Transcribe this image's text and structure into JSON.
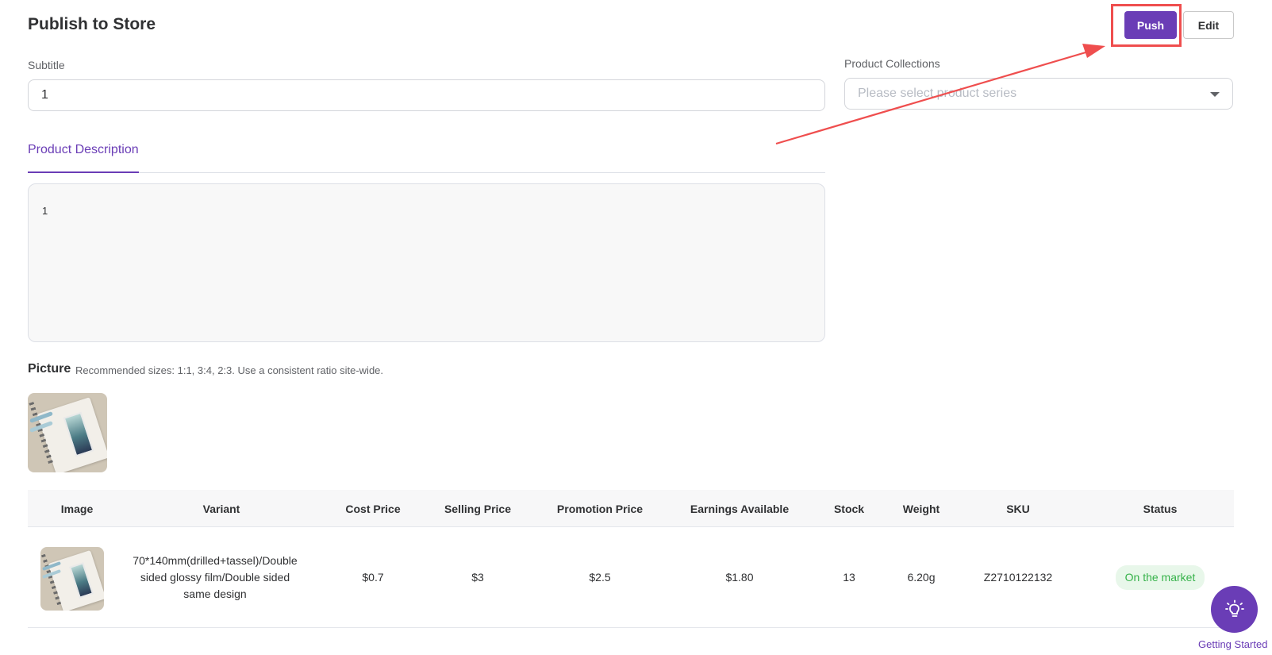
{
  "header": {
    "title": "Publish to Store",
    "push_label": "Push",
    "edit_label": "Edit"
  },
  "form": {
    "subtitle_label": "Subtitle",
    "subtitle_value": "1",
    "collections_label": "Product Collections",
    "collections_placeholder": "Please select product series"
  },
  "tabs": {
    "active_label": "Product Description"
  },
  "description": {
    "content": "1"
  },
  "picture": {
    "title": "Picture",
    "hint": "Recommended sizes: 1:1, 3:4, 2:3. Use a consistent ratio site-wide."
  },
  "table": {
    "headers": [
      "Image",
      "Variant",
      "Cost Price",
      "Selling Price",
      "Promotion Price",
      "Earnings Available",
      "Stock",
      "Weight",
      "SKU",
      "Status"
    ],
    "rows": [
      {
        "variant": "70*140mm(drilled+tassel)/Double sided glossy film/Double sided same design",
        "cost_price": "$0.7",
        "selling_price": "$3",
        "promotion_price": "$2.5",
        "earnings": "$1.80",
        "stock": "13",
        "weight": "6.20g",
        "sku": "Z2710122132",
        "status": "On the market"
      }
    ]
  },
  "fab": {
    "label": "Getting Started",
    "icon": "lightbulb-icon"
  },
  "colors": {
    "accent": "#6a3db6",
    "highlight": "#ef4e4e",
    "status_green": "#36b24a"
  }
}
